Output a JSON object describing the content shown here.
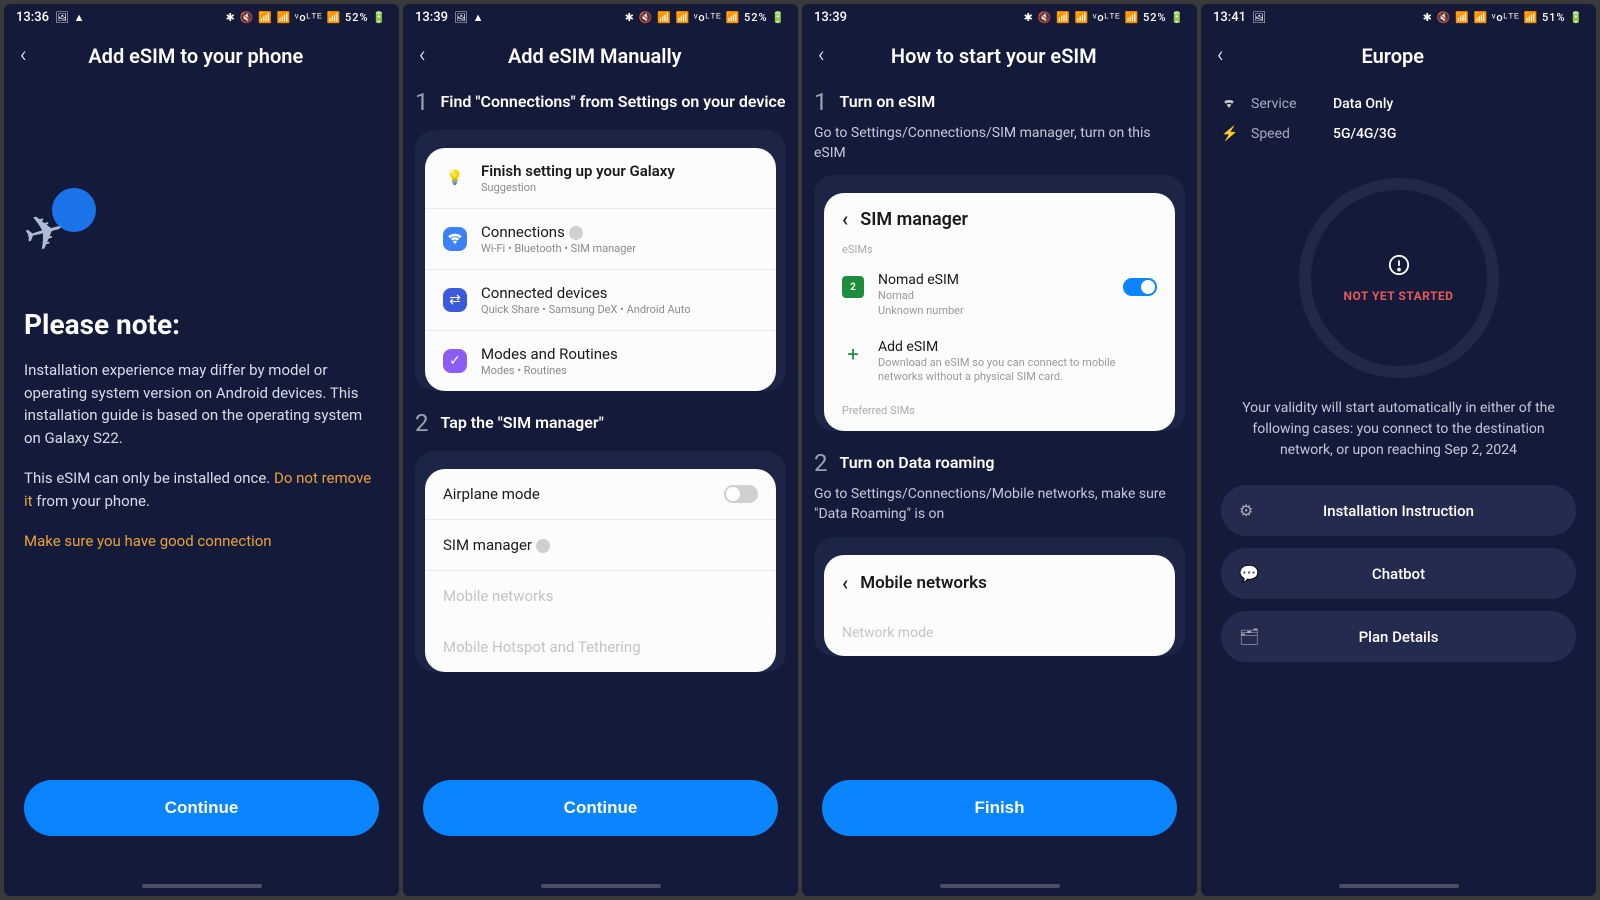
{
  "screen1": {
    "time": "13:36",
    "status_icons_left": "🖼 ▲",
    "status_icons_right": "✱ 🔇 📶 📶 ᵛoᴸᵀᴱ 📶 52% 🔋",
    "title": "Add eSIM to your phone",
    "note_heading": "Please note:",
    "para1": "Installation experience may differ by model or operating system version on Android devices. This installation guide is based on the operating system on Galaxy S22.",
    "para2a": "This eSIM can only be installed once. ",
    "para2b": "Do not remove it",
    "para2c": " from your phone.",
    "para3": "Make sure you have good connection",
    "cta": "Continue"
  },
  "screen2": {
    "time": "13:39",
    "status_icons_left": "🖼 ▲",
    "status_icons_right": "✱ 🔇 📶 📶 ᵛoᴸᵀᴱ 📶 52% 🔋",
    "title": "Add eSIM Manually",
    "step1_num": "1",
    "step1_text": "Find \"Connections\" from Settings on your device",
    "step2_num": "2",
    "step2_text": "Tap the \"SIM manager\"",
    "card1": {
      "r1_title": "Finish setting up your Galaxy",
      "r1_sub": "Suggestion",
      "r2_title": "Connections",
      "r2_sub": "Wi-Fi  •  Bluetooth  •  SIM manager",
      "r3_title": "Connected devices",
      "r3_sub": "Quick Share  •  Samsung DeX  •  Android Auto",
      "r4_title": "Modes and Routines",
      "r4_sub": "Modes  •  Routines"
    },
    "card2": {
      "r1": "Airplane mode",
      "r2": "SIM manager",
      "r3": "Mobile networks",
      "r4": "Mobile Hotspot and Tethering"
    },
    "cta": "Continue"
  },
  "screen3": {
    "time": "13:39",
    "status_icons_right": "✱ 🔇 📶 📶 ᵛoᴸᵀᴱ 📶 52% 🔋",
    "title": "How to start your eSIM",
    "step1_num": "1",
    "step1_text": "Turn on eSIM",
    "step1_sub": "Go to Settings/Connections/SIM manager, turn on this eSIM",
    "step2_num": "2",
    "step2_text": "Turn on Data roaming",
    "step2_sub": "Go to Settings/Connections/Mobile networks, make sure \"Data Roaming\" is on",
    "sim_card": {
      "header": "SIM manager",
      "esims_label": "eSIMs",
      "nomad_title": "Nomad eSIM",
      "nomad_sub1": "Nomad",
      "nomad_sub2": "Unknown number",
      "add_title": "Add eSIM",
      "add_sub": "Download an eSIM so you can connect to mobile networks without a physical SIM card.",
      "pref": "Preferred SIMs"
    },
    "net_card": {
      "header": "Mobile networks",
      "r1": "Network mode"
    },
    "cta": "Finish"
  },
  "screen4": {
    "time": "13:41",
    "status_icons_left": "🖼",
    "status_icons_right": "✱ 🔇 📶 📶 ᵛoᴸᵀᴱ 📶 51% 🔋",
    "title": "Europe",
    "service_label": "Service",
    "service_value": "Data Only",
    "speed_label": "Speed",
    "speed_value": "5G/4G/3G",
    "status_text": "NOT YET STARTED",
    "validity": "Your validity will start automatically in either of the following cases: you connect to the destination network, or upon reaching Sep 2, 2024",
    "btn1": "Installation Instruction",
    "btn2": "Chatbot",
    "btn3": "Plan Details"
  }
}
